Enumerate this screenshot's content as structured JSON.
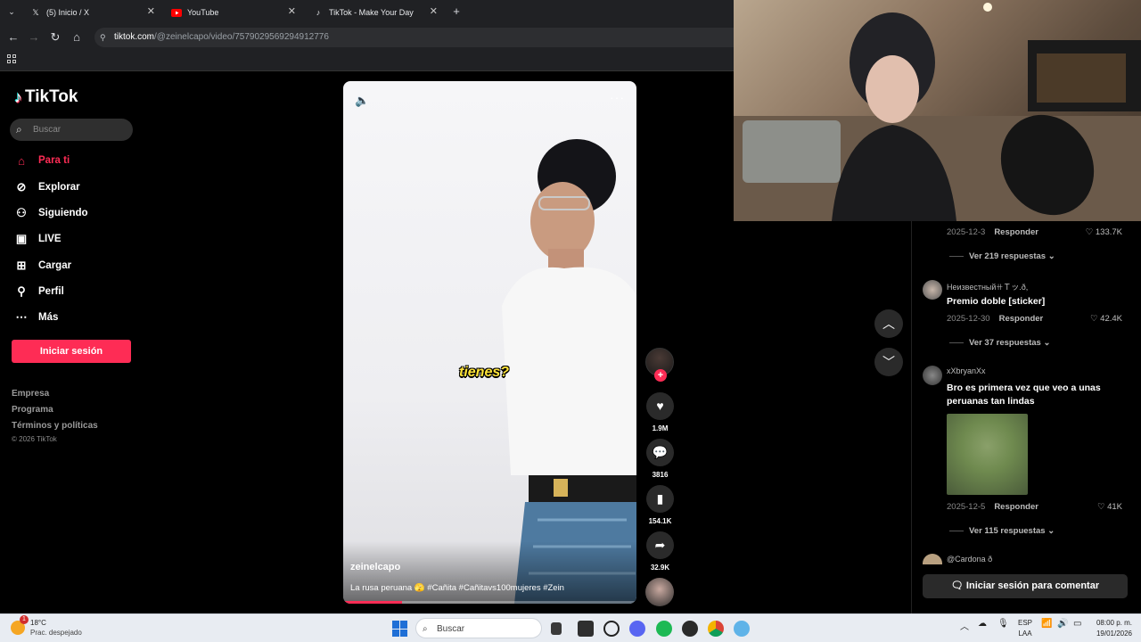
{
  "browser": {
    "tabs": [
      {
        "label": "(5) Inicio / X",
        "icon": "x-logo-icon"
      },
      {
        "label": "YouTube",
        "icon": "youtube-icon"
      },
      {
        "label": "TikTok - Make Your Day",
        "icon": "tiktok-icon"
      }
    ],
    "new_tab": "+",
    "url_host": "tiktok.com",
    "url_path": "/@zeinelcapo/video/7579029569294912776"
  },
  "sidebar": {
    "logo": "TikTok",
    "search_placeholder": "Buscar",
    "nav": [
      {
        "label": "Para ti",
        "icon": "home-icon",
        "active": true
      },
      {
        "label": "Explorar",
        "icon": "compass-icon"
      },
      {
        "label": "Siguiendo",
        "icon": "following-icon"
      },
      {
        "label": "LIVE",
        "icon": "live-tv-icon"
      },
      {
        "label": "Cargar",
        "icon": "upload-icon"
      },
      {
        "label": "Perfil",
        "icon": "profile-icon"
      },
      {
        "label": "Más",
        "icon": "more-icon"
      }
    ],
    "login": "Iniciar sesión",
    "footer_links": [
      "Empresa",
      "Programa",
      "Términos y políticas"
    ],
    "copyright": "© 2026 TikTok"
  },
  "video": {
    "caption_overlay": "tienes?",
    "username": "zeinelcapo",
    "description": "La rusa peruana 🫣 #Cañita #Cañitavs100mujeres #Zein",
    "progress": 0.2,
    "likes": "1.9M",
    "comments": "3816",
    "saves": "154.1K",
    "shares": "32.9K"
  },
  "comments": {
    "items": [
      {
        "date": "2025-12-3",
        "reply": "Responder",
        "likes": "133.7K",
        "replies": "Ver 219 respuestas"
      },
      {
        "user": "НеизвестныйꔠＴッ.ð,",
        "text": "Premio doble [sticker]",
        "date": "2025-12-30",
        "reply": "Responder",
        "likes": "42.4K",
        "replies": "Ver 37 respuestas"
      },
      {
        "user": "xXbryanXx",
        "text": "Bro es primera vez que veo a unas peruanas tan lindas",
        "date": "2025-12-5",
        "reply": "Responder",
        "likes": "41K",
        "replies": "Ver 115 respuestas"
      },
      {
        "user": "@Cardona ð"
      }
    ],
    "login_to_comment": "Iniciar sesión para comentar"
  },
  "taskbar": {
    "temp": "18°C",
    "weather": "Prac. despejado",
    "notification_badge": "1",
    "search": "Buscar",
    "lang_top": "ESP",
    "lang_bottom": "LAA",
    "time": "08:00 p. m.",
    "date": "19/01/2026"
  }
}
